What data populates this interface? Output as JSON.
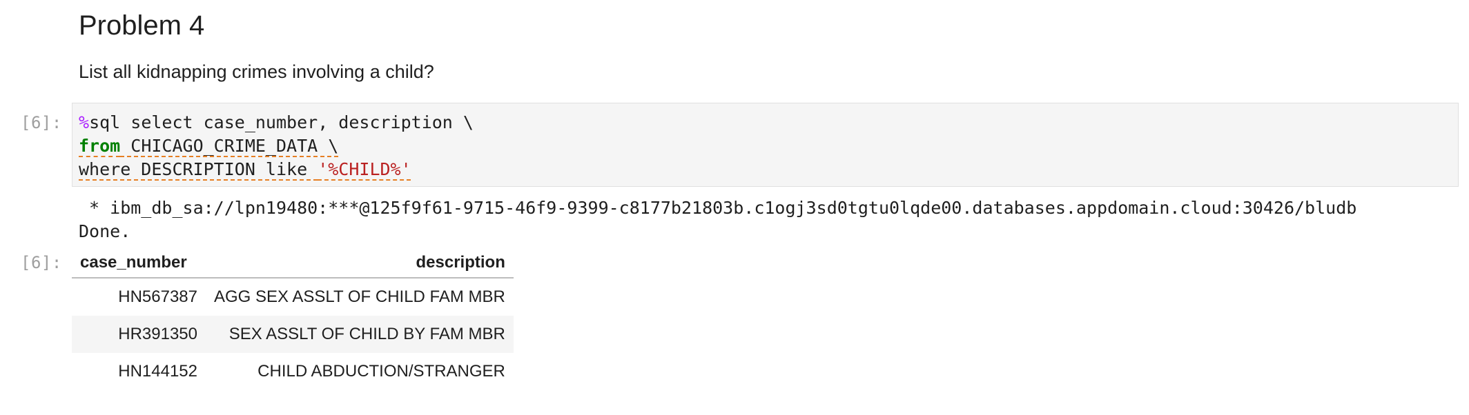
{
  "markdown": {
    "heading": "Problem 4",
    "paragraph": "List all kidnapping crimes involving a child?"
  },
  "cell": {
    "input_prompt": "[6]:",
    "output_prompt": "[6]:",
    "code": {
      "line1_magic": "%",
      "line1_rest": "sql select case_number, description \\",
      "line2_keyword": "from",
      "line2_rest": " CHICAGO_CRIME_DATA \\",
      "line3_code": "where DESCRIPTION like ",
      "line3_string": "'%CHILD%'"
    },
    "stream": {
      "connection": " * ibm_db_sa://lpn19480:***@125f9f61-9715-46f9-9399-c8177b21803b.c1ogj3sd0tgtu0lqde00.databases.appdomain.cloud:30426/bludb",
      "done": "Done."
    }
  },
  "table": {
    "headers": [
      "case_number",
      "description"
    ],
    "rows": [
      [
        "HN567387",
        "AGG SEX ASSLT OF CHILD FAM MBR"
      ],
      [
        "HR391350",
        "SEX ASSLT OF CHILD BY FAM MBR"
      ],
      [
        "HN144152",
        "CHILD ABDUCTION/STRANGER"
      ]
    ]
  },
  "colors": {
    "magic": "#aa22ff",
    "keyword": "#008000",
    "string": "#ba2121",
    "squiggle": "#e67e22",
    "prompt": "#9e9e9e",
    "cell_background": "#f5f5f5"
  }
}
